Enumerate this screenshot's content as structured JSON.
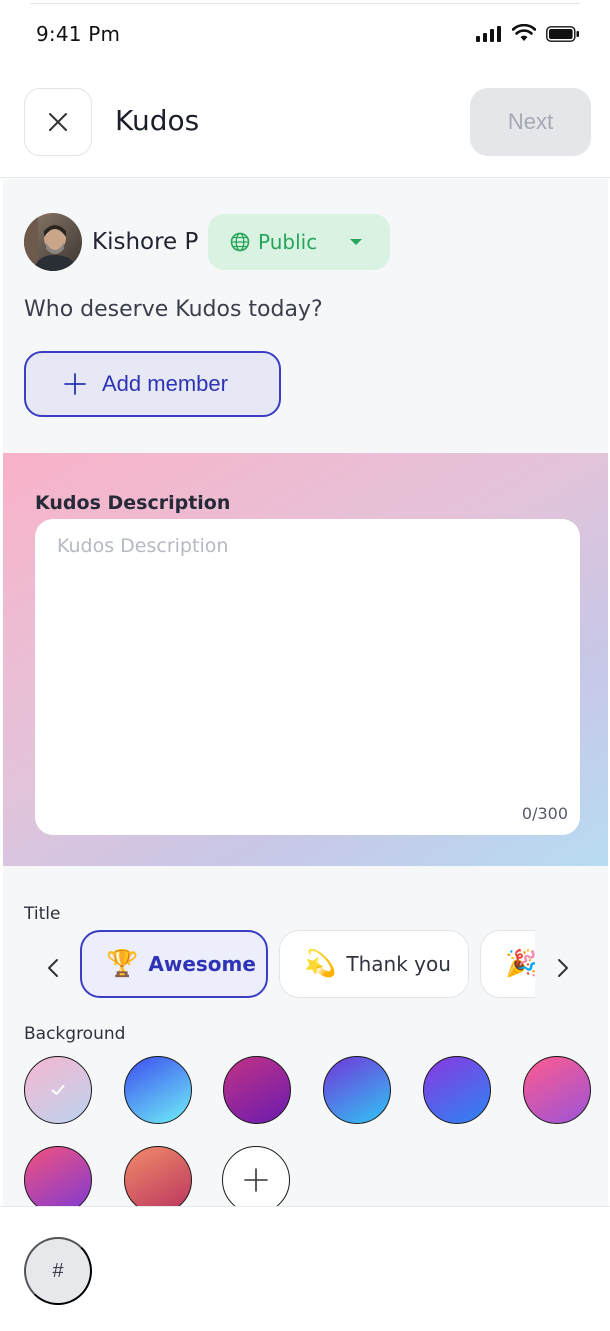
{
  "status_bar": {
    "time": "9:41 Pm",
    "icons": [
      "cellular-icon",
      "wifi-icon",
      "battery-icon"
    ]
  },
  "header": {
    "title": "Kudos",
    "close_icon": "close-icon",
    "next_label": "Next"
  },
  "author": {
    "name": "Kishore P",
    "visibility": "Public",
    "visibility_icon": "globe-icon"
  },
  "prompt": "Who deserve Kudos today?",
  "add_member": {
    "label": "Add member",
    "icon": "plus-icon"
  },
  "description": {
    "label": "Kudos Description",
    "placeholder": "Kudos Description",
    "counter": "0/300"
  },
  "title_section": {
    "label": "Title",
    "chips": [
      {
        "emoji": "🏆",
        "label": "Awesome",
        "selected": true
      },
      {
        "emoji": "💫",
        "label": "Thank you",
        "selected": false
      },
      {
        "emoji": "🎉",
        "label": "",
        "selected": false
      }
    ]
  },
  "background_section": {
    "label": "Background",
    "swatches": [
      {
        "name": "pink-lavender",
        "colors": [
          "#f6b7cf",
          "#bcd3ef"
        ],
        "selected": true
      },
      {
        "name": "blue-cyan",
        "colors": [
          "#3d4cf0",
          "#6ff1f7"
        ],
        "selected": false
      },
      {
        "name": "magenta-purple",
        "colors": [
          "#c23385",
          "#6a1bb0"
        ],
        "selected": false
      },
      {
        "name": "purple-skyblue",
        "colors": [
          "#7334d9",
          "#2fc7f5"
        ],
        "selected": false
      },
      {
        "name": "violet-blue",
        "colors": [
          "#8a37e0",
          "#2b86f3"
        ],
        "selected": false
      },
      {
        "name": "pink-violet",
        "colors": [
          "#ff5b8d",
          "#9b54d9"
        ],
        "selected": false
      },
      {
        "name": "pink-purple",
        "colors": [
          "#f2527e",
          "#7c3ad5"
        ],
        "selected": false
      },
      {
        "name": "coral-rose",
        "colors": [
          "#f28b6a",
          "#b8345e"
        ],
        "selected": false
      }
    ],
    "add_icon": "plus-icon"
  },
  "bottom_bar": {
    "hashtag_label": "#"
  },
  "colors": {
    "accent": "#3a3ec2",
    "public_green": "#26a65b",
    "public_bg": "#d9f2e2",
    "next_disabled_bg": "#e4e6ea"
  }
}
